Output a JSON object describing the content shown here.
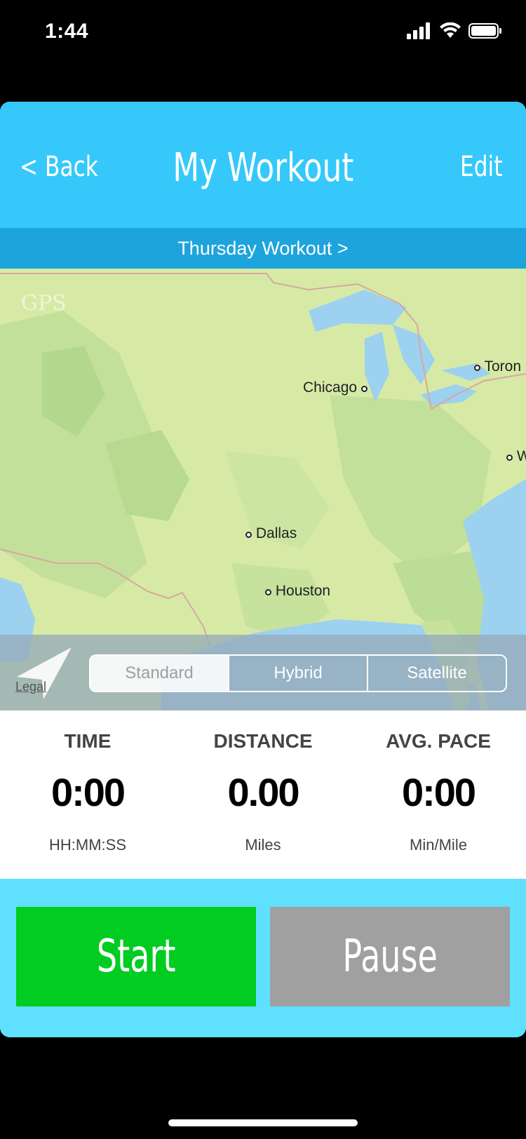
{
  "status_bar": {
    "time": "1:44"
  },
  "nav": {
    "back_label": "< Back",
    "title": "My Workout",
    "edit_label": "Edit"
  },
  "subheader": {
    "label": "Thursday Workout >"
  },
  "map": {
    "gps_label": "GPS",
    "cities": {
      "chicago": "Chicago",
      "toronto": "Toron",
      "dallas": "Dallas",
      "houston": "Houston",
      "washington": "W"
    },
    "legal_label": "Legal",
    "map_types": [
      "Standard",
      "Hybrid",
      "Satellite"
    ],
    "selected_type": "Standard"
  },
  "stats": {
    "time": {
      "label": "TIME",
      "value": "0:00",
      "unit": "HH:MM:SS"
    },
    "distance": {
      "label": "DISTANCE",
      "value": "0.00",
      "unit": "Miles"
    },
    "pace": {
      "label": "AVG. PACE",
      "value": "0:00",
      "unit": "Min/Mile"
    }
  },
  "controls": {
    "start_label": "Start",
    "pause_label": "Pause"
  },
  "colors": {
    "nav": "#36c8fa",
    "subheader": "#1ea4dc",
    "start": "#00cc22",
    "pause": "#a0a0a0",
    "background": "#5fe0ff"
  }
}
